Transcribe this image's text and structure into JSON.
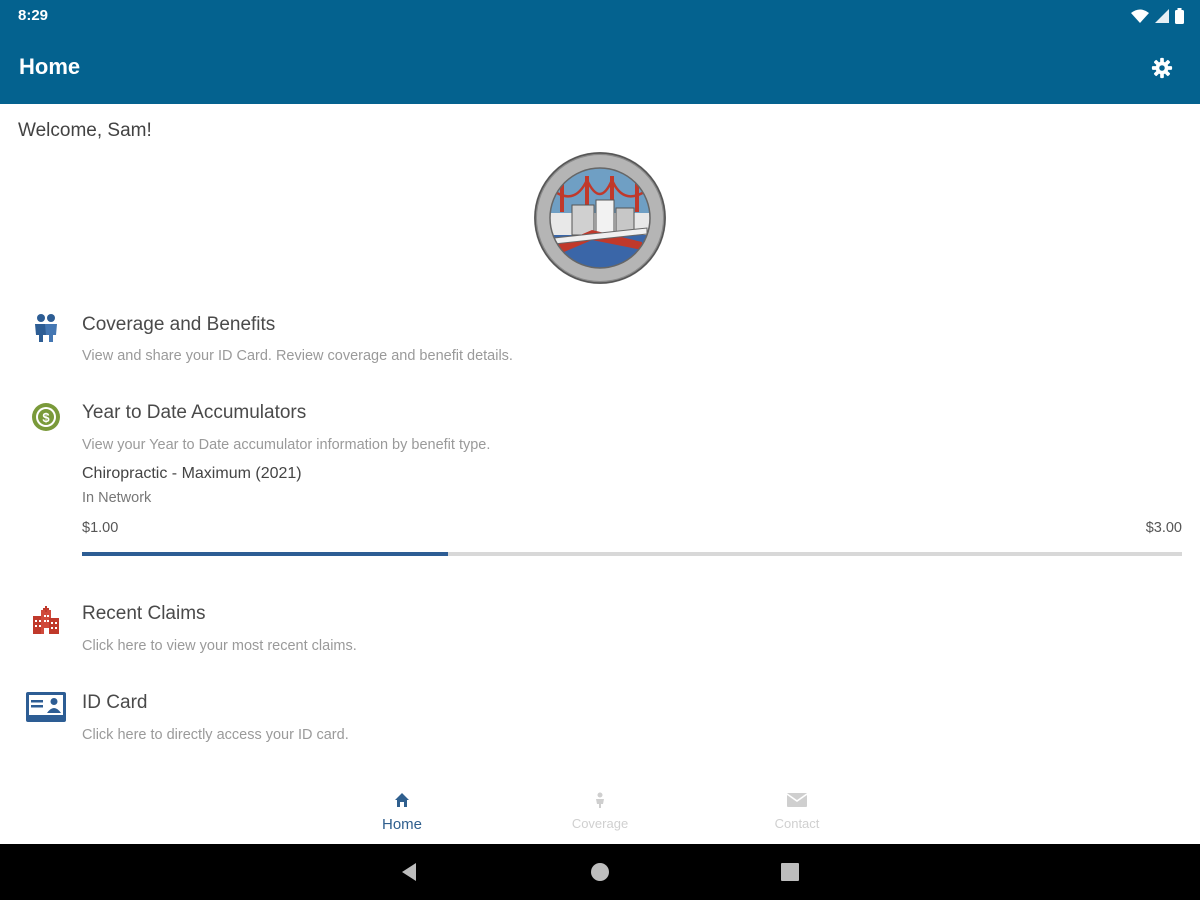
{
  "status_bar": {
    "time": "8:29"
  },
  "app_bar": {
    "title": "Home"
  },
  "welcome": {
    "text": "Welcome,  Sam!"
  },
  "sections": {
    "coverage": {
      "title": "Coverage and Benefits",
      "description": "View and share your ID Card. Review coverage and benefit details."
    },
    "accumulators": {
      "title": "Year to Date Accumulators",
      "description": "View your Year to Date accumulator information by benefit type.",
      "item": {
        "name": "Chiropractic - Maximum (2021)",
        "network": "In Network",
        "used": "$1.00",
        "max": "$3.00",
        "progress_fraction": 0.333
      }
    },
    "claims": {
      "title": "Recent Claims",
      "description": "Click here to view your most recent claims."
    },
    "id_card": {
      "title": "ID Card",
      "description": "Click here to directly access your ID card."
    }
  },
  "bottom_nav": {
    "items": [
      {
        "label": "Home",
        "icon": "home-icon",
        "active": true
      },
      {
        "label": "Coverage",
        "icon": "coverage-icon",
        "active": false
      },
      {
        "label": "Contact",
        "icon": "mail-icon",
        "active": false
      }
    ]
  },
  "colors": {
    "primary": "#04628f",
    "accent_blue": "#2d5d94",
    "money_green": "#7a9a3a",
    "claims_red": "#c0392b"
  }
}
